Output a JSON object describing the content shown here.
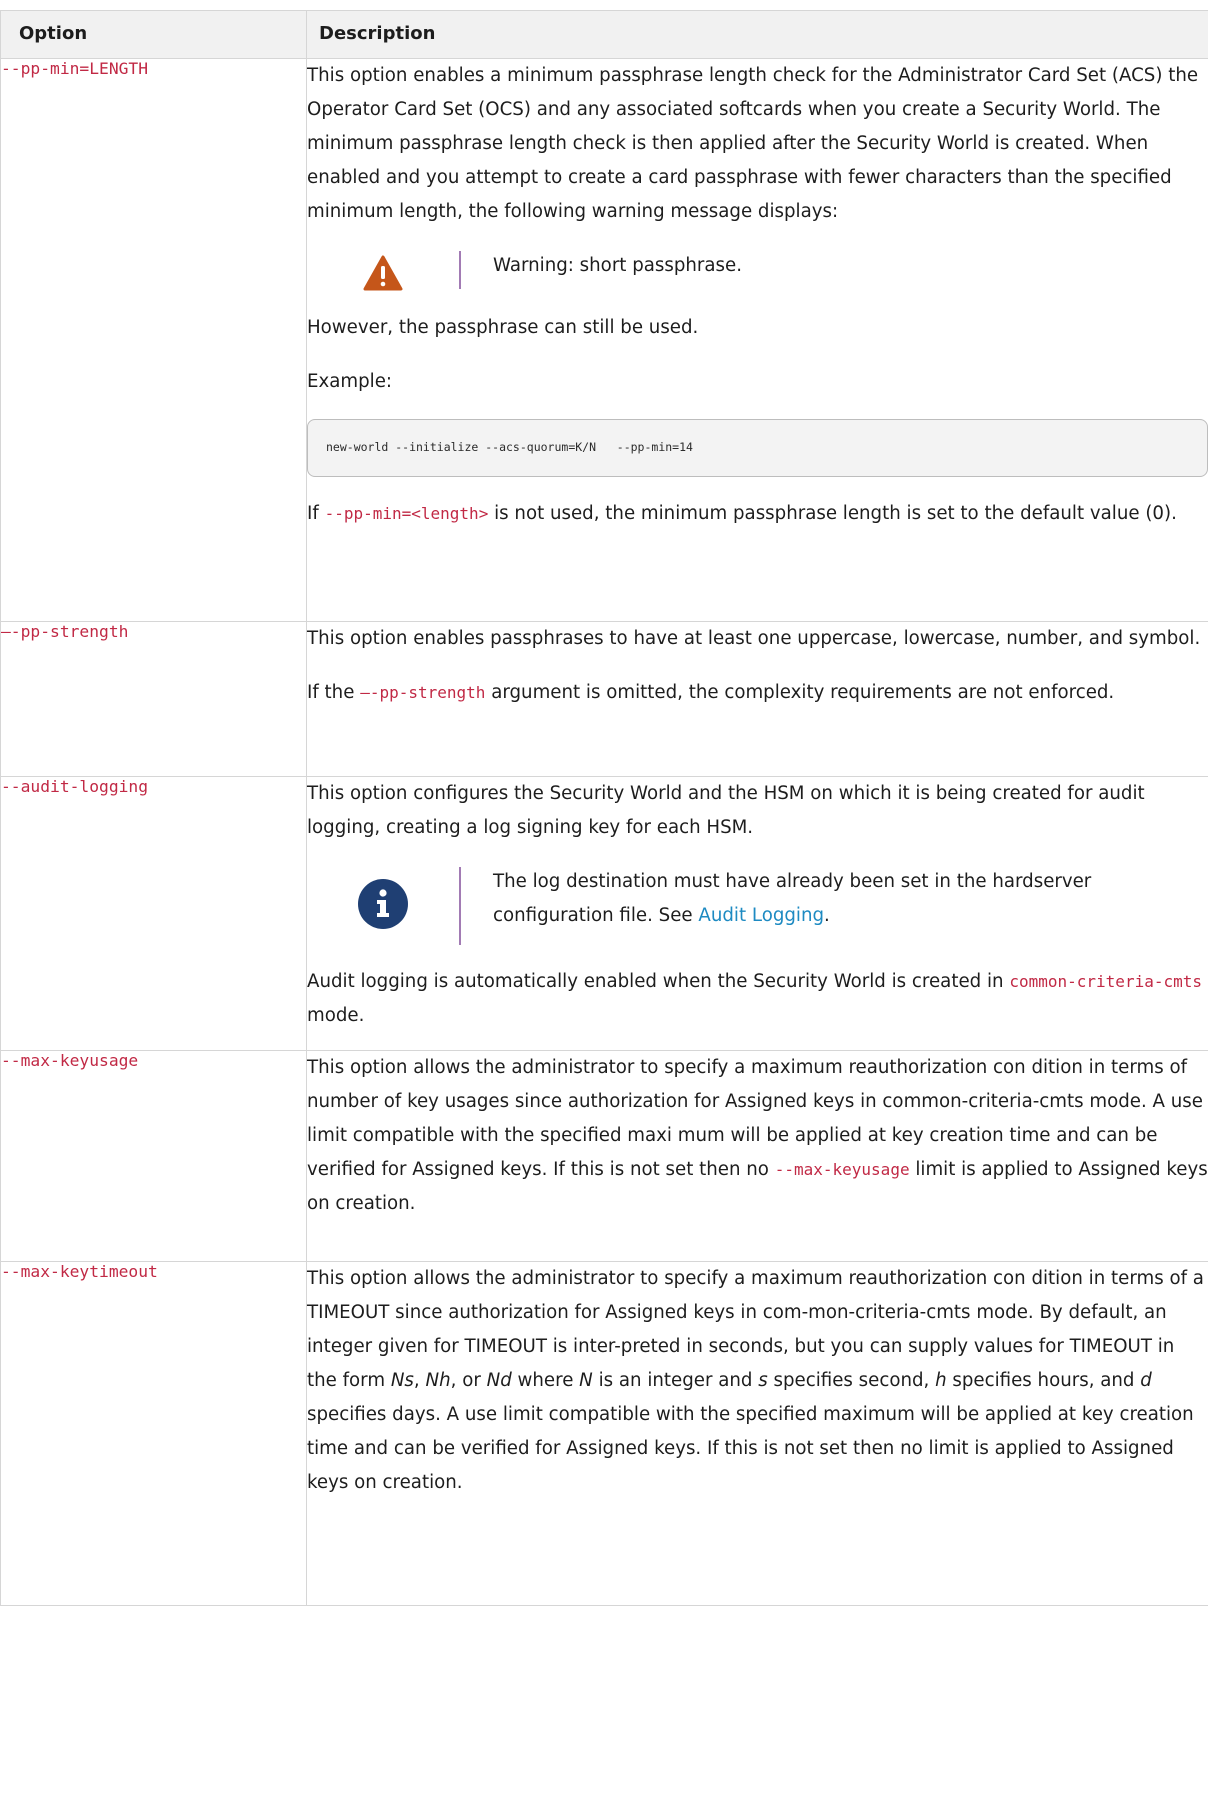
{
  "table": {
    "header_option": "Option",
    "header_description": "Description"
  },
  "rows": [
    {
      "option": "--pp-min=LENGTH",
      "p1": "This option enables a minimum passphrase length check for the Administrator Card Set (ACS) the Operator Card Set (OCS) and any associated softcards when you create a Security World. The minimum passphrase length check is then applied after the Security World is created. When enabled and you attempt to create a card passphrase with fewer characters than the specified minimum length, the following warning message displays:",
      "warning_text": "Warning: short passphrase.",
      "p2": "However, the passphrase can still be used.",
      "p3": "Example:",
      "code": "new-world --initialize --acs-quorum=K/N   --pp-min=14",
      "p4_pre": "If ",
      "p4_code": "--pp-min=<length>",
      "p4_post": " is not used, the minimum passphrase length is set to the default value (0)."
    },
    {
      "option": "—-pp-strength",
      "p1": "This option enables passphrases to have at least one uppercase, lowercase, number, and symbol.",
      "p2_pre": "If the ",
      "p2_code": "—-pp-strength",
      "p2_post": " argument is omitted, the complexity requirements are not enforced."
    },
    {
      "option": "--audit-logging",
      "p1": "This option configures the Security World and the HSM on which it is being created for audit logging, creating a log signing key for each HSM.",
      "note_text": "The log destination must have already been set in the hardserver configuration file. See ",
      "note_link": "Audit Logging",
      "note_end": ".",
      "p2": "Audit logging is automatically enabled when the Security World is created in ",
      "p2_code": "common-criteria-cmts",
      "p2_post": " mode."
    },
    {
      "option": "--max-keyusage",
      "p1_pre": "This option allows the administrator to specify a maximum reauthorization con dition in terms of number of key usages since authorization for Assigned keys in common-criteria-cmts mode. A use limit compatible with the specified maxi mum will be applied at key creation time and can be verified for Assigned keys. If this is not set then no ",
      "p1_code": "--max-keyusage",
      "p1_post": " limit is applied to Assigned keys on creation."
    },
    {
      "option": "--max-keytimeout",
      "t1": "This option allows the administrator to specify a maximum reauthorization con dition in terms of a TIMEOUT since authorization for Assigned keys in com-mon-criteria-cmts mode. By default, an integer given for TIMEOUT is inter-preted in seconds, but you can supply values for TIMEOUT in the form ",
      "ns": "Ns",
      "c1": ", ",
      "nh": "Nh",
      "c2": ", or ",
      "nd": "Nd",
      "t2": " where ",
      "n": "N",
      "t3": " is an integer and ",
      "s": "s",
      "t4": " specifies second, ",
      "h": "h",
      "t5": " specifies hours, and ",
      "d": "d",
      "t6": " specifies days. A use limit compatible with the specified maximum will be applied at key creation time and can be verified for Assigned keys. If this is not set then no limit is applied to Assigned keys on creation."
    }
  ],
  "colors": {
    "code": "#c12945",
    "link": "#1d8ac2",
    "warning": "#c5561a",
    "info": "#1f3f73",
    "divider": "#a27bb4"
  }
}
